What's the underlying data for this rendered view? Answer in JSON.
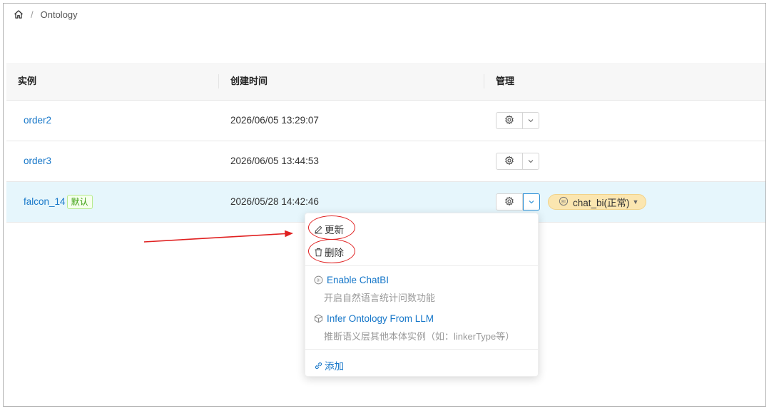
{
  "breadcrumb": {
    "current": "Ontology",
    "separator": "/"
  },
  "table": {
    "columns": [
      "实例",
      "创建时间",
      "管理"
    ],
    "rows": [
      {
        "name": "order2",
        "created": "2026/06/05 13:29:07",
        "default_tag": ""
      },
      {
        "name": "order3",
        "created": "2026/06/05 13:44:53",
        "default_tag": ""
      },
      {
        "name": "falcon_14",
        "created": "2026/05/28 14:42:46",
        "default_tag": "默认"
      }
    ]
  },
  "chatbi_badge": {
    "label": "chat_bi(正常)"
  },
  "menu": {
    "update_label": "更新",
    "delete_label": "删除",
    "enable_chatbi": {
      "title": "Enable ChatBI",
      "desc": "开启自然语言统计问数功能"
    },
    "infer_ontology": {
      "title": "Infer Ontology From LLM",
      "desc": "推断语义层其他本体实例（如：linkerType等）"
    },
    "add_label": "添加"
  },
  "colors": {
    "link": "#1677c9",
    "selected_row": "#e6f6fc",
    "annotation": "#e02020",
    "badge": "#fbe6b0"
  },
  "icons": [
    "home-icon",
    "gear-icon",
    "chevron-down-icon",
    "edit-icon",
    "trash-icon",
    "chatbi-icon",
    "cube-icon",
    "link-icon"
  ]
}
